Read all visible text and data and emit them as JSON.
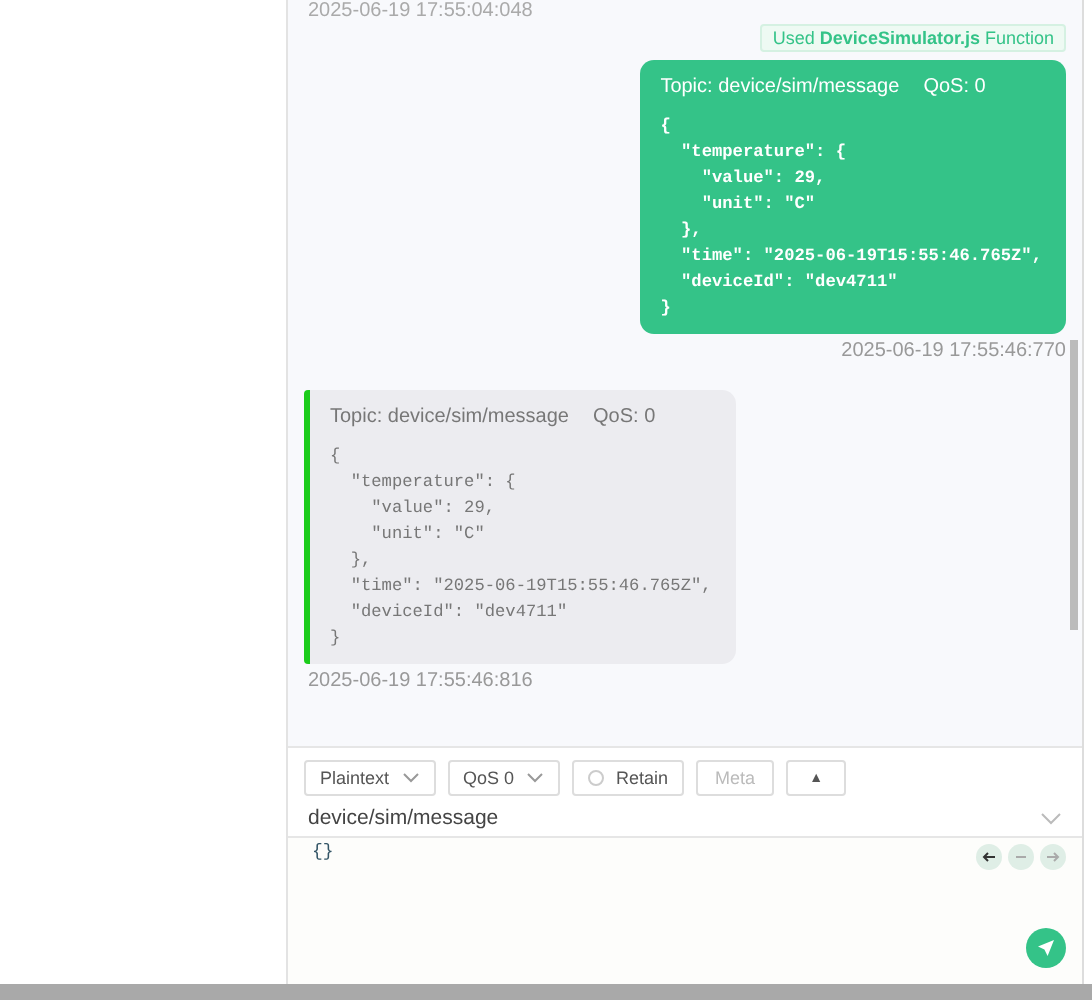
{
  "top_timestamp": "2025-06-19 17:55:04:048",
  "messages": [
    {
      "kind": "sent",
      "badge": "Used **DeviceSimulator.js** Function",
      "topic": "Topic: device/sim/message",
      "qos": "QoS: 0",
      "payload": "{\n  \"temperature\": {\n    \"value\": 29,\n    \"unit\": \"C\"\n  },\n  \"time\": \"2025-06-19T15:55:46.765Z\",\n  \"deviceId\": \"dev4711\"\n}",
      "timestamp": "2025-06-19 17:55:46:770"
    },
    {
      "kind": "received",
      "topic": "Topic: device/sim/message",
      "qos": "QoS: 0",
      "payload": "{\n  \"temperature\": {\n    \"value\": 29,\n    \"unit\": \"C\"\n  },\n  \"time\": \"2025-06-19T15:55:46.765Z\",\n  \"deviceId\": \"dev4711\"\n}",
      "timestamp": "2025-06-19 17:55:46:816"
    }
  ],
  "composer": {
    "format": "Plaintext",
    "qos": "QoS 0",
    "retain": {
      "label": "Retain",
      "checked": false
    },
    "meta": {
      "label": "Meta",
      "disabled": true
    },
    "expand": "▲",
    "topic": "device/sim/message",
    "payload": "{}"
  }
}
